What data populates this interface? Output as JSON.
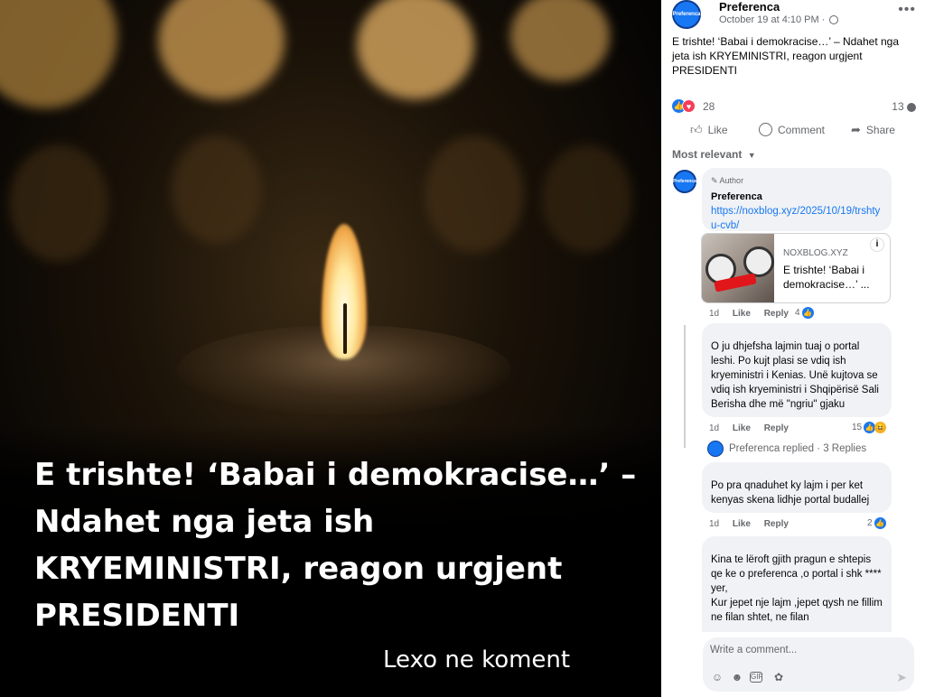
{
  "image": {
    "headline": "E trishte! ‘Babai i demokracise…’ – Ndahet nga jeta ish KRYEMINISTRI, reagon urgjent PRESIDENTI",
    "cta": "Lexo ne koment"
  },
  "post": {
    "author": "Preferenca",
    "avatar_text": "Preferenca",
    "date": "October 19 at 4:10 PM ·",
    "privacy_icon": "globe-icon",
    "text": "E trishte! ‘Babai i demokracise…’ – Ndahet nga jeta ish KRYEMINISTRI, reagon urgjent PRESIDENTI",
    "reaction_count": "28",
    "comment_count": "13",
    "actions": {
      "like": "Like",
      "comment": "Comment",
      "share": "Share"
    },
    "sort_label": "Most relevant"
  },
  "comments": [
    {
      "badge": "Author",
      "name": "Preferenca",
      "link": "https://noxblog.xyz/2025/10/19/trshtyu-cvb/",
      "card": {
        "domain": "NOXBLOG.XYZ",
        "title": "E trishte! ‘Babai i demokracise…’ ..."
      },
      "time": "1d",
      "like": "Like",
      "reply": "Reply",
      "likes": "4"
    },
    {
      "text": "O ju dhjefsha lajmin tuaj o portal leshi. Po kujt plasi se vdiq ish kryeministri i Kenias. Unë kujtova se vdiq ish kryeministri i Shqipërisë Sali Berisha dhe më \"ngriu\" gjaku",
      "time": "1d",
      "like": "Like",
      "reply": "Reply",
      "likes": "15"
    },
    {
      "replied": "Preferenca replied · 3 Replies"
    },
    {
      "text": "Po pra qnaduhet ky lajm i per ket kenyas skena lidhje portal budallej",
      "time": "1d",
      "like": "Like",
      "reply": "Reply",
      "likes": "2"
    },
    {
      "text": "Kina te lëroft gjith pragun e shtepis qe ke o preferenca ,o portal i shk **** yer,\nKur jepet nje lajm ,jepet qysh ne fillim ne filan shtet, ne filan"
    }
  ],
  "composer": {
    "placeholder": "Write a comment..."
  }
}
